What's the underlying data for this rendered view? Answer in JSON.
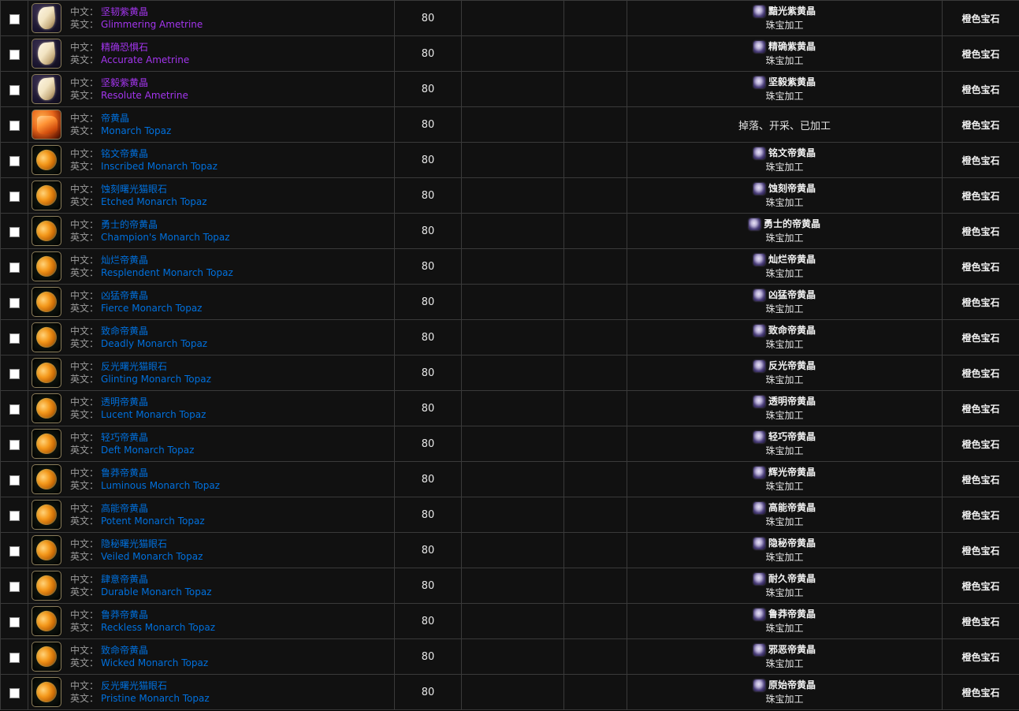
{
  "table": {
    "labels": {
      "zh_prefix": "中文：",
      "en_prefix": "英文：",
      "profession": "珠宝加工",
      "category": "橙色宝石"
    },
    "rows": [
      {
        "level": "80",
        "icon": "gem-ametrine",
        "quality": "q-epic",
        "name_zh": "坚韧紫黄晶",
        "name_en": "Glimmering Ametrine",
        "source_type": "crafted",
        "source_name": "黯光紫黄晶",
        "source_prof": "珠宝加工",
        "category": "橙色宝石"
      },
      {
        "level": "80",
        "icon": "gem-ametrine",
        "quality": "q-epic",
        "name_zh": "精确恐惧石",
        "name_en": "Accurate Ametrine",
        "source_type": "crafted",
        "source_name": "精确紫黄晶",
        "source_prof": "珠宝加工",
        "category": "橙色宝石"
      },
      {
        "level": "80",
        "icon": "gem-ametrine",
        "quality": "q-epic",
        "name_zh": "坚毅紫黄晶",
        "name_en": "Resolute Ametrine",
        "source_type": "crafted",
        "source_name": "坚毅紫黄晶",
        "source_prof": "珠宝加工",
        "category": "橙色宝石"
      },
      {
        "level": "80",
        "icon": "gem-topaz-raw",
        "quality": "q-rare",
        "name_zh": "帝黄晶",
        "name_en": "Monarch Topaz",
        "source_type": "plain",
        "source_text": "掉落、开采、已加工",
        "category": "橙色宝石"
      },
      {
        "level": "80",
        "icon": "gem-topaz-cut",
        "quality": "q-rare",
        "name_zh": "铭文帝黄晶",
        "name_en": "Inscribed Monarch Topaz",
        "source_type": "crafted",
        "source_name": "铭文帝黄晶",
        "source_prof": "珠宝加工",
        "category": "橙色宝石"
      },
      {
        "level": "80",
        "icon": "gem-topaz-cut",
        "quality": "q-rare",
        "name_zh": "蚀刻曙光猫眼石",
        "name_en": "Etched Monarch Topaz",
        "source_type": "crafted",
        "source_name": "蚀刻帝黄晶",
        "source_prof": "珠宝加工",
        "category": "橙色宝石"
      },
      {
        "level": "80",
        "icon": "gem-topaz-cut",
        "quality": "q-rare",
        "name_zh": "勇士的帝黄晶",
        "name_en": "Champion's Monarch Topaz",
        "source_type": "crafted",
        "source_name": "勇士的帝黄晶",
        "source_prof": "珠宝加工",
        "category": "橙色宝石"
      },
      {
        "level": "80",
        "icon": "gem-topaz-cut",
        "quality": "q-rare",
        "name_zh": "灿烂帝黄晶",
        "name_en": "Resplendent Monarch Topaz",
        "source_type": "crafted",
        "source_name": "灿烂帝黄晶",
        "source_prof": "珠宝加工",
        "category": "橙色宝石"
      },
      {
        "level": "80",
        "icon": "gem-topaz-cut",
        "quality": "q-rare",
        "name_zh": "凶猛帝黄晶",
        "name_en": "Fierce Monarch Topaz",
        "source_type": "crafted",
        "source_name": "凶猛帝黄晶",
        "source_prof": "珠宝加工",
        "category": "橙色宝石"
      },
      {
        "level": "80",
        "icon": "gem-topaz-cut",
        "quality": "q-rare",
        "name_zh": "致命帝黄晶",
        "name_en": "Deadly Monarch Topaz",
        "source_type": "crafted",
        "source_name": "致命帝黄晶",
        "source_prof": "珠宝加工",
        "category": "橙色宝石"
      },
      {
        "level": "80",
        "icon": "gem-topaz-cut",
        "quality": "q-rare",
        "name_zh": "反光曙光猫眼石",
        "name_en": "Glinting Monarch Topaz",
        "source_type": "crafted",
        "source_name": "反光帝黄晶",
        "source_prof": "珠宝加工",
        "category": "橙色宝石"
      },
      {
        "level": "80",
        "icon": "gem-topaz-cut",
        "quality": "q-rare",
        "name_zh": "透明帝黄晶",
        "name_en": "Lucent Monarch Topaz",
        "source_type": "crafted",
        "source_name": "透明帝黄晶",
        "source_prof": "珠宝加工",
        "category": "橙色宝石"
      },
      {
        "level": "80",
        "icon": "gem-topaz-cut",
        "quality": "q-rare",
        "name_zh": "轻巧帝黄晶",
        "name_en": "Deft Monarch Topaz",
        "source_type": "crafted",
        "source_name": "轻巧帝黄晶",
        "source_prof": "珠宝加工",
        "category": "橙色宝石"
      },
      {
        "level": "80",
        "icon": "gem-topaz-cut",
        "quality": "q-rare",
        "name_zh": "鲁莽帝黄晶",
        "name_en": "Luminous Monarch Topaz",
        "source_type": "crafted",
        "source_name": "辉光帝黄晶",
        "source_prof": "珠宝加工",
        "category": "橙色宝石"
      },
      {
        "level": "80",
        "icon": "gem-topaz-cut",
        "quality": "q-rare",
        "name_zh": "高能帝黄晶",
        "name_en": "Potent Monarch Topaz",
        "source_type": "crafted",
        "source_name": "高能帝黄晶",
        "source_prof": "珠宝加工",
        "category": "橙色宝石"
      },
      {
        "level": "80",
        "icon": "gem-topaz-cut",
        "quality": "q-rare",
        "name_zh": "隐秘曙光猫眼石",
        "name_en": "Veiled Monarch Topaz",
        "source_type": "crafted",
        "source_name": "隐秘帝黄晶",
        "source_prof": "珠宝加工",
        "category": "橙色宝石"
      },
      {
        "level": "80",
        "icon": "gem-topaz-cut",
        "quality": "q-rare",
        "name_zh": "肆意帝黄晶",
        "name_en": "Durable Monarch Topaz",
        "source_type": "crafted",
        "source_name": "耐久帝黄晶",
        "source_prof": "珠宝加工",
        "category": "橙色宝石"
      },
      {
        "level": "80",
        "icon": "gem-topaz-cut",
        "quality": "q-rare",
        "name_zh": "鲁莽帝黄晶",
        "name_en": "Reckless Monarch Topaz",
        "source_type": "crafted",
        "source_name": "鲁莽帝黄晶",
        "source_prof": "珠宝加工",
        "category": "橙色宝石"
      },
      {
        "level": "80",
        "icon": "gem-topaz-cut",
        "quality": "q-rare",
        "name_zh": "致命帝黄晶",
        "name_en": "Wicked Monarch Topaz",
        "source_type": "crafted",
        "source_name": "邪恶帝黄晶",
        "source_prof": "珠宝加工",
        "category": "橙色宝石"
      },
      {
        "level": "80",
        "icon": "gem-topaz-cut",
        "quality": "q-rare",
        "name_zh": "反光曙光猫眼石",
        "name_en": "Pristine Monarch Topaz",
        "source_type": "crafted",
        "source_name": "原始帝黄晶",
        "source_prof": "珠宝加工",
        "category": "橙色宝石"
      }
    ]
  }
}
